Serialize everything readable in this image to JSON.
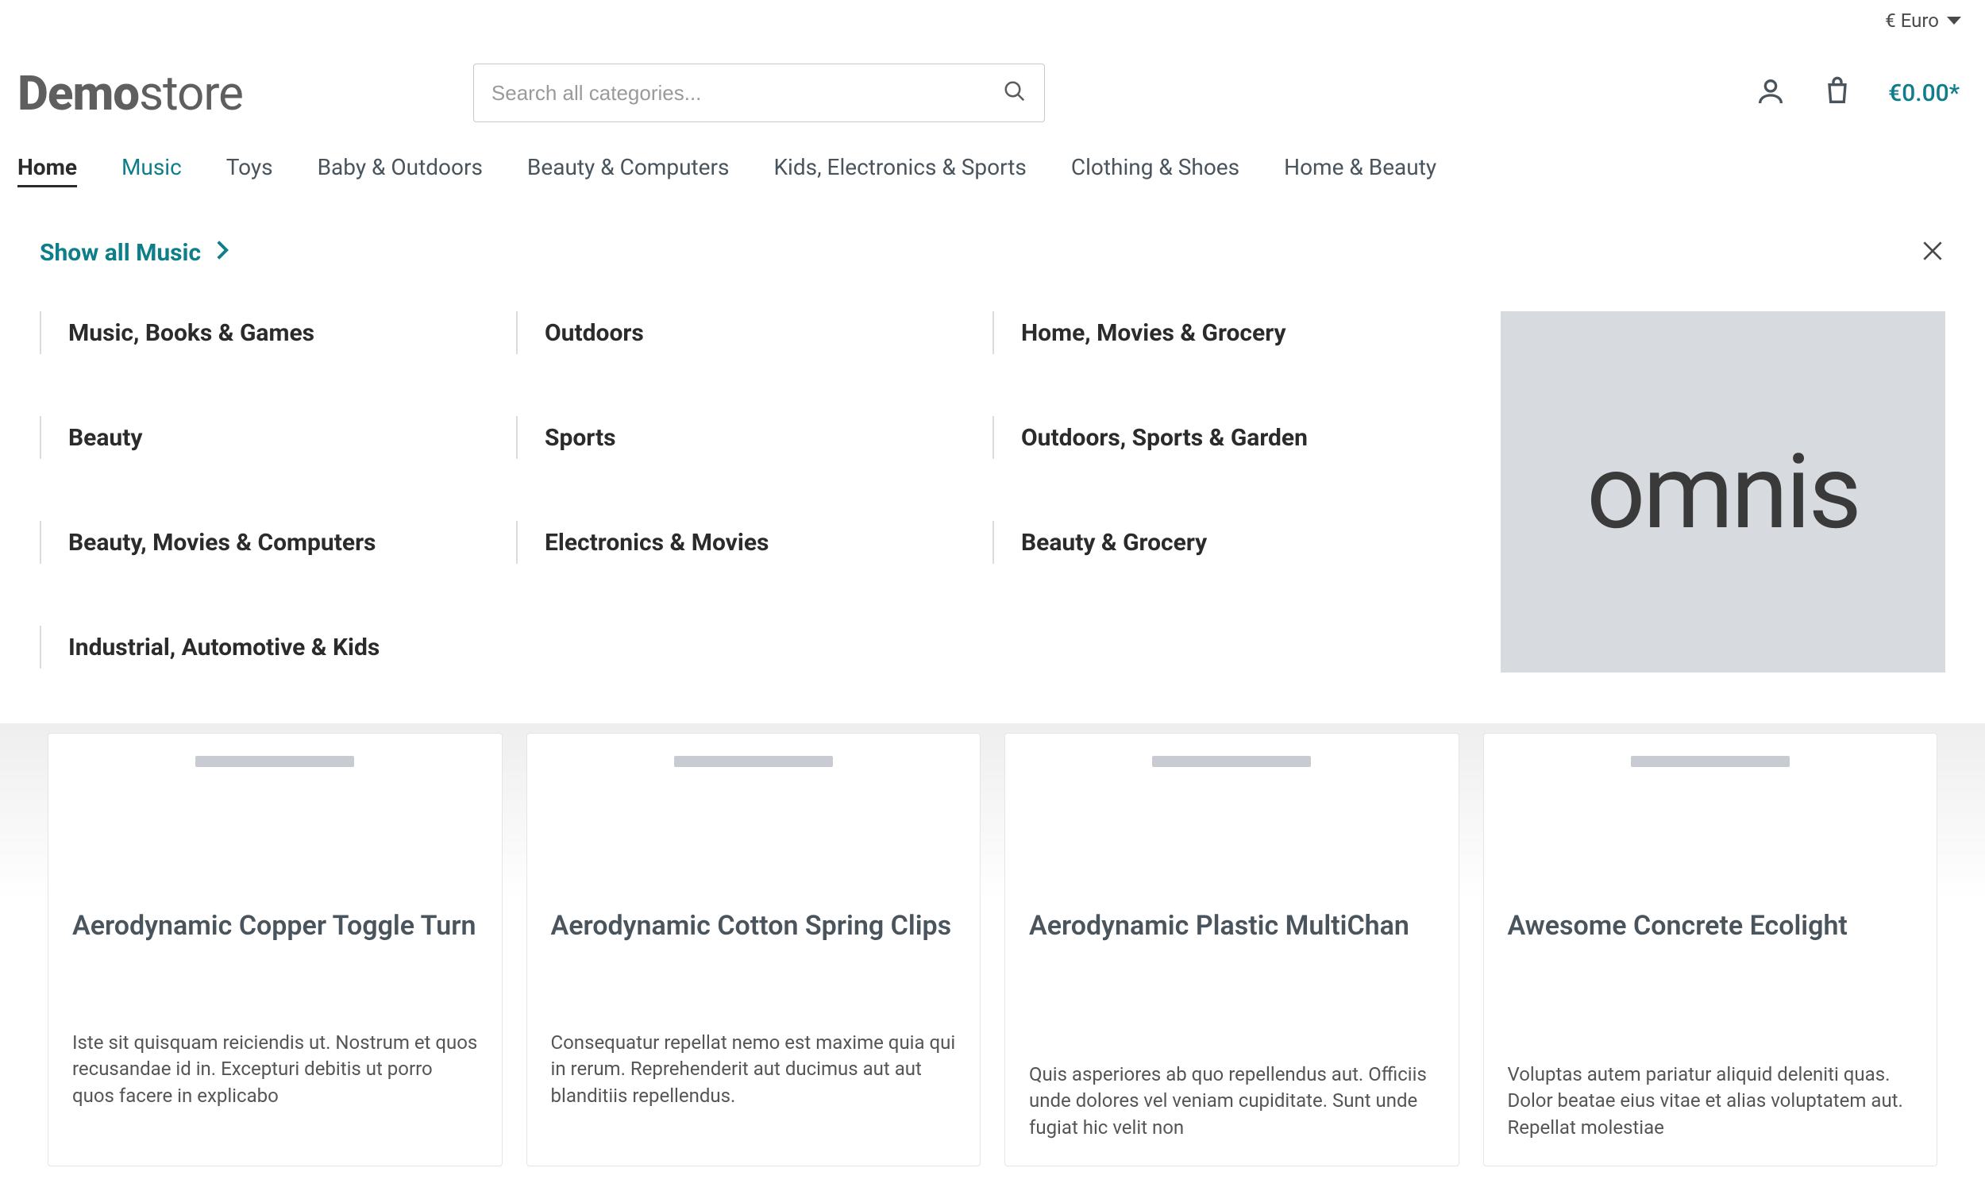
{
  "topbar": {
    "currency_label": "€ Euro"
  },
  "logo": {
    "bold": "Demo",
    "light": "store"
  },
  "search": {
    "placeholder": "Search all categories..."
  },
  "cart": {
    "total": "€0.00*"
  },
  "nav": {
    "items": [
      {
        "label": "Home"
      },
      {
        "label": "Music"
      },
      {
        "label": "Toys"
      },
      {
        "label": "Baby & Outdoors"
      },
      {
        "label": "Beauty & Computers"
      },
      {
        "label": "Kids, Electronics & Sports"
      },
      {
        "label": "Clothing & Shoes"
      },
      {
        "label": "Home & Beauty"
      }
    ]
  },
  "mega": {
    "show_all": "Show all Music",
    "columns": [
      [
        "Music, Books & Games",
        "Beauty",
        "Beauty, Movies & Computers",
        "Industrial, Automotive & Kids"
      ],
      [
        "Outdoors",
        "Sports",
        "Electronics & Movies"
      ],
      [
        "Home, Movies & Grocery",
        "Outdoors, Sports & Garden",
        "Beauty & Grocery"
      ]
    ],
    "promo_text": "omnis"
  },
  "products": [
    {
      "title": "Aerodynamic Copper Toggle Turn",
      "desc": "Iste sit quisquam reiciendis ut. Nostrum et quos recusandae id in. Excepturi debitis ut porro quos facere in explicabo"
    },
    {
      "title": "Aerodynamic Cotton Spring Clips",
      "desc": "Consequatur repellat nemo est maxime quia qui in rerum. Reprehenderit aut ducimus aut aut blanditiis repellendus."
    },
    {
      "title": "Aerodynamic Plastic MultiChan",
      "desc": "Quis asperiores ab quo repellendus aut. Officiis unde dolores vel veniam cupiditate. Sunt unde fugiat hic velit non"
    },
    {
      "title": "Awesome Concrete Ecolight",
      "desc": "Voluptas autem pariatur aliquid deleniti quas. Dolor beatae eius vitae et alias voluptatem aut. Repellat molestiae"
    }
  ]
}
